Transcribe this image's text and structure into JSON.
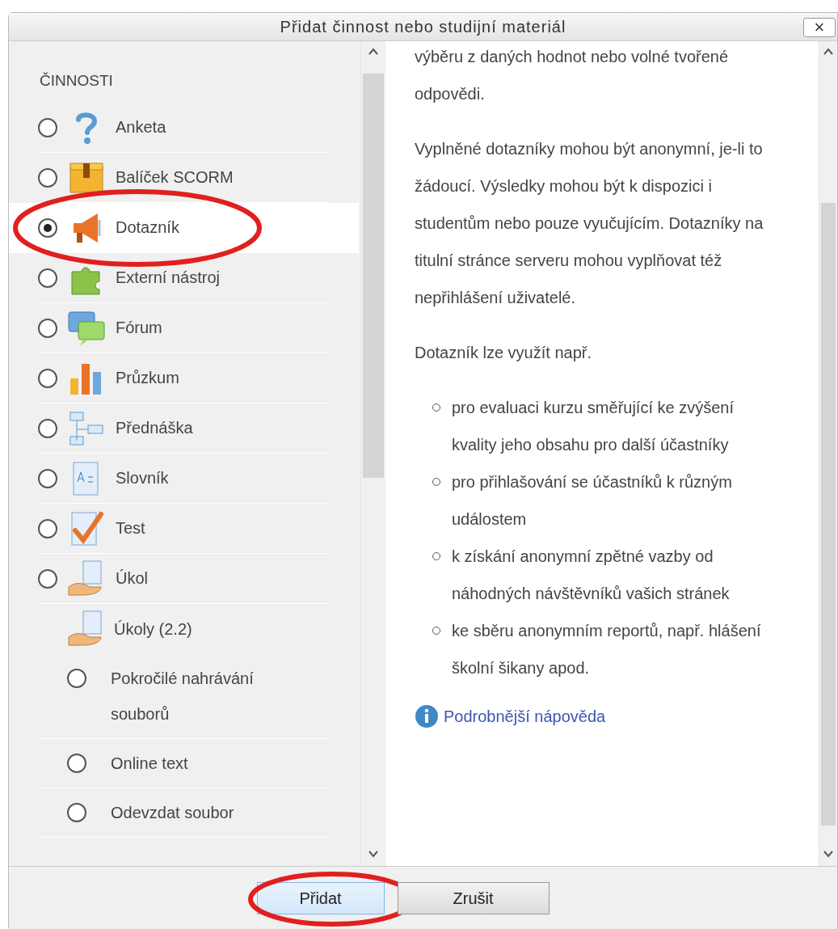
{
  "dialog": {
    "title": "Přidat činnost nebo studijní materiál",
    "close": "×"
  },
  "activities": {
    "heading": "ČINNOSTI",
    "items": [
      {
        "kind": "radio",
        "label": "Anketa",
        "selected": false,
        "highlighted": false
      },
      {
        "kind": "radio",
        "label": "Balíček SCORM",
        "selected": false,
        "highlighted": false
      },
      {
        "kind": "radio",
        "label": "Dotazník",
        "selected": true,
        "highlighted": true
      },
      {
        "kind": "radio",
        "label": "Externí nástroj",
        "selected": false,
        "highlighted": false
      },
      {
        "kind": "radio",
        "label": "Fórum",
        "selected": false,
        "highlighted": false
      },
      {
        "kind": "radio",
        "label": "Průzkum",
        "selected": false,
        "highlighted": false
      },
      {
        "kind": "radio",
        "label": "Přednáška",
        "selected": false,
        "highlighted": false
      },
      {
        "kind": "radio",
        "label": "Slovník",
        "selected": false,
        "highlighted": false
      },
      {
        "kind": "radio",
        "label": "Test",
        "selected": false,
        "highlighted": false
      },
      {
        "kind": "radio",
        "label": "Úkol",
        "selected": false,
        "highlighted": false
      },
      {
        "kind": "group",
        "label": "Úkoly (2.2)",
        "children": [
          {
            "label": "Pokročilé nahrávání souborů",
            "selected": false
          },
          {
            "label": "Online text",
            "selected": false
          },
          {
            "label": "Odevzdat soubor",
            "selected": false
          }
        ]
      }
    ]
  },
  "description": {
    "paragraphs": [
      "výběru z daných hodnot nebo volné tvořené odpovědi.",
      "Vyplněné dotazníky mohou být anonymní, je-li to žádoucí. Výsledky mohou být k dispozici i studentům nebo pouze vyučujícím. Dotazníky na titulní stránce serveru mohou vyplňovat též nepřihlášení uživatelé.",
      "Dotazník lze využít např."
    ],
    "bullets": [
      "pro evaluaci kurzu směřující ke zvýšení kvality jeho obsahu pro další účastníky",
      "pro přihlašování se účastníků k různým událostem",
      "k získání anonymní zpětné vazby od náhodných návštěvníků vašich stránek",
      "ke sběru anonymním reportů, např. hlášení školní šikany apod."
    ],
    "help_link": "Podrobnější nápověda"
  },
  "buttons": [
    {
      "label": "Přidat",
      "kind": "primary",
      "highlighted": true
    },
    {
      "label": "Zrušit",
      "kind": "secondary",
      "highlighted": false
    }
  ]
}
